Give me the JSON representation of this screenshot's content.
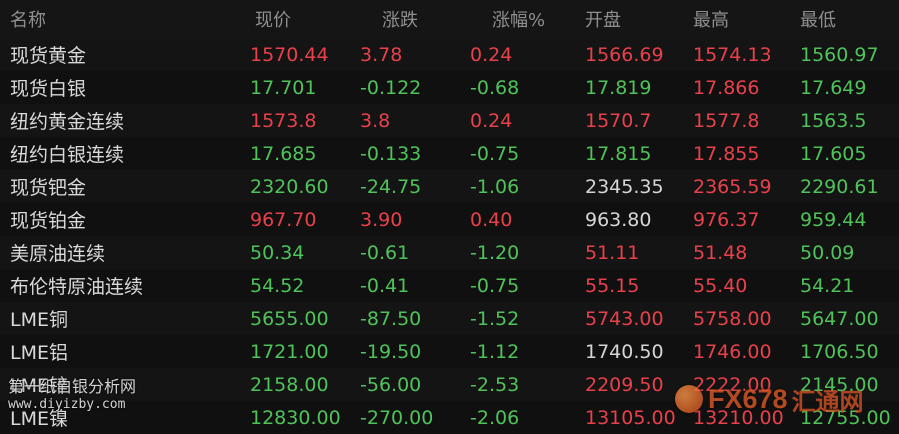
{
  "columns": {
    "name": "名称",
    "price": "现价",
    "change": "涨跌",
    "change_pct": "涨幅%",
    "open": "开盘",
    "high": "最高",
    "low": "最低"
  },
  "rows": [
    {
      "name": "现货黄金",
      "price": "1570.44",
      "change": "3.78",
      "change_pct": "0.24",
      "open": "1566.69",
      "high": "1574.13",
      "low": "1560.97"
    },
    {
      "name": "现货白银",
      "price": "17.701",
      "change": "-0.122",
      "change_pct": "-0.68",
      "open": "17.819",
      "high": "17.866",
      "low": "17.649"
    },
    {
      "name": "纽约黄金连续",
      "price": "1573.8",
      "change": "3.8",
      "change_pct": "0.24",
      "open": "1570.7",
      "high": "1577.8",
      "low": "1563.5"
    },
    {
      "name": "纽约白银连续",
      "price": "17.685",
      "change": "-0.133",
      "change_pct": "-0.75",
      "open": "17.815",
      "high": "17.855",
      "low": "17.605"
    },
    {
      "name": "现货钯金",
      "price": "2320.60",
      "change": "-24.75",
      "change_pct": "-1.06",
      "open": "2345.35",
      "high": "2365.59",
      "low": "2290.61"
    },
    {
      "name": "现货铂金",
      "price": "967.70",
      "change": "3.90",
      "change_pct": "0.40",
      "open": "963.80",
      "high": "976.37",
      "low": "959.44"
    },
    {
      "name": "美原油连续",
      "price": "50.34",
      "change": "-0.61",
      "change_pct": "-1.20",
      "open": "51.11",
      "high": "51.48",
      "low": "50.09"
    },
    {
      "name": "布伦特原油连续",
      "price": "54.52",
      "change": "-0.41",
      "change_pct": "-0.75",
      "open": "55.15",
      "high": "55.40",
      "low": "54.21"
    },
    {
      "name": "LME铜",
      "price": "5655.00",
      "change": "-87.50",
      "change_pct": "-1.52",
      "open": "5743.00",
      "high": "5758.00",
      "low": "5647.00"
    },
    {
      "name": "LME铝",
      "price": "1721.00",
      "change": "-19.50",
      "change_pct": "-1.12",
      "open": "1740.50",
      "high": "1746.00",
      "low": "1706.50"
    },
    {
      "name": "LME锌",
      "price": "2158.00",
      "change": "-56.00",
      "change_pct": "-2.53",
      "open": "2209.50",
      "high": "2222.00",
      "low": "2145.00"
    },
    {
      "name": "LME镍",
      "price": "12830.00",
      "change": "-270.00",
      "change_pct": "-2.06",
      "open": "13105.00",
      "high": "13210.00",
      "low": "12755.00"
    }
  ],
  "colors": {
    "background": "#0d0d0d",
    "header_text": "#8f8f8f",
    "up": "#e8414b",
    "down": "#4fc35a",
    "flat": "#d6d6d6"
  },
  "row_colors": [
    {
      "price": "up",
      "change": "up",
      "change_pct": "up",
      "open": "up",
      "high": "up",
      "low": "down"
    },
    {
      "price": "down",
      "change": "down",
      "change_pct": "down",
      "open": "down",
      "high": "up",
      "low": "down"
    },
    {
      "price": "up",
      "change": "up",
      "change_pct": "up",
      "open": "up",
      "high": "up",
      "low": "down"
    },
    {
      "price": "down",
      "change": "down",
      "change_pct": "down",
      "open": "down",
      "high": "up",
      "low": "down"
    },
    {
      "price": "down",
      "change": "down",
      "change_pct": "down",
      "open": "flat",
      "high": "up",
      "low": "down"
    },
    {
      "price": "up",
      "change": "up",
      "change_pct": "up",
      "open": "flat",
      "high": "up",
      "low": "down"
    },
    {
      "price": "down",
      "change": "down",
      "change_pct": "down",
      "open": "up",
      "high": "up",
      "low": "down"
    },
    {
      "price": "down",
      "change": "down",
      "change_pct": "down",
      "open": "up",
      "high": "up",
      "low": "down"
    },
    {
      "price": "down",
      "change": "down",
      "change_pct": "down",
      "open": "up",
      "high": "up",
      "low": "down"
    },
    {
      "price": "down",
      "change": "down",
      "change_pct": "down",
      "open": "flat",
      "high": "up",
      "low": "down"
    },
    {
      "price": "down",
      "change": "down",
      "change_pct": "down",
      "open": "up",
      "high": "up",
      "low": "down"
    },
    {
      "price": "down",
      "change": "down",
      "change_pct": "down",
      "open": "up",
      "high": "up",
      "low": "down"
    }
  ],
  "watermark": {
    "left_title": "第一纸白银分析网",
    "left_url": "www.diyizby.com",
    "right_brand": "FX678",
    "right_sub": "汇通网"
  }
}
